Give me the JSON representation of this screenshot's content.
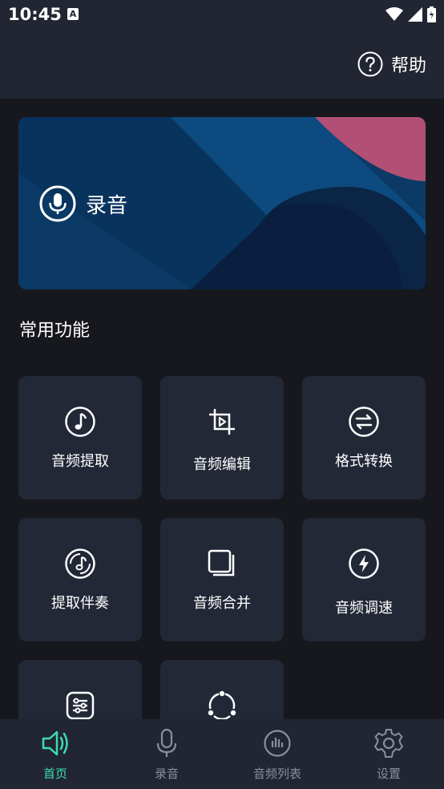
{
  "status_bar": {
    "time": "10:45",
    "notification_badge": "A"
  },
  "header": {
    "help_label": "帮助"
  },
  "banner": {
    "record_label": "录音"
  },
  "section": {
    "title": "常用功能"
  },
  "features": [
    {
      "label": "音频提取",
      "icon": "music-note-icon"
    },
    {
      "label": "音频编辑",
      "icon": "crop-play-icon"
    },
    {
      "label": "格式转换",
      "icon": "convert-arrows-icon"
    },
    {
      "label": "提取伴奏",
      "icon": "disc-note-icon"
    },
    {
      "label": "音频合并",
      "icon": "stacked-squares-icon"
    },
    {
      "label": "音频调速",
      "icon": "lightning-icon"
    },
    {
      "label": "",
      "icon": "sliders-icon"
    },
    {
      "label": "",
      "icon": "share-circle-icon"
    }
  ],
  "bottom_nav": {
    "items": [
      {
        "label": "首页",
        "icon": "speaker-icon",
        "active": true
      },
      {
        "label": "录音",
        "icon": "microphone-icon",
        "active": false
      },
      {
        "label": "音频列表",
        "icon": "audio-list-icon",
        "active": false
      },
      {
        "label": "设置",
        "icon": "gear-icon",
        "active": false
      }
    ]
  },
  "colors": {
    "background": "#17181d",
    "header": "#212632",
    "tile": "#232837",
    "accent": "#3ddbb0",
    "inactive": "#8a8f9c",
    "banner_pink": "#b24f74",
    "banner_blue": "#0b4d80"
  }
}
